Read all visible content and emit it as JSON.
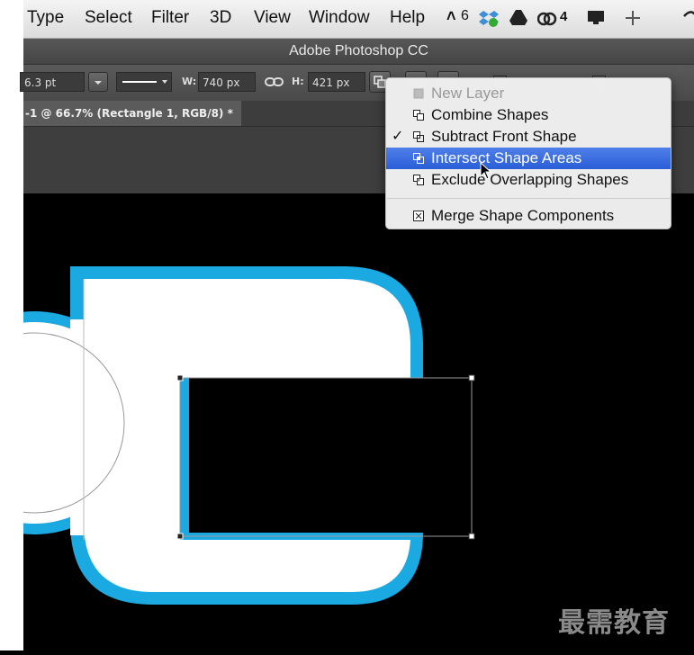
{
  "menubar": {
    "items": [
      "Type",
      "Select",
      "Filter",
      "3D",
      "View",
      "Window",
      "Help"
    ],
    "tray": {
      "adobe_count": "6",
      "cc_count": "4"
    }
  },
  "titlebar": {
    "title": "Adobe Photoshop CC"
  },
  "options": {
    "stroke_size": "6.3 pt",
    "width_label": "W:",
    "width_value": "740 px",
    "height_label": "H:",
    "height_value": "421 px"
  },
  "document_tab": {
    "label": "-1 @ 66.7% (Rectangle 1, RGB/8) *"
  },
  "path_operations_menu": {
    "items": [
      {
        "label": "New Layer",
        "state": "disabled"
      },
      {
        "label": "Combine Shapes",
        "state": "normal"
      },
      {
        "label": "Subtract Front Shape",
        "state": "checked"
      },
      {
        "label": "Intersect Shape Areas",
        "state": "highlighted"
      },
      {
        "label": "Exclude Overlapping Shapes",
        "state": "normal"
      },
      {
        "label": "Merge Shape Components",
        "state": "normal"
      }
    ],
    "checkmark": "✓"
  },
  "colors": {
    "shape_stroke": "#1ba9e1",
    "shape_fill": "#ffffff",
    "menu_highlight": "#3a6ee0"
  },
  "watermark": "最需教育"
}
